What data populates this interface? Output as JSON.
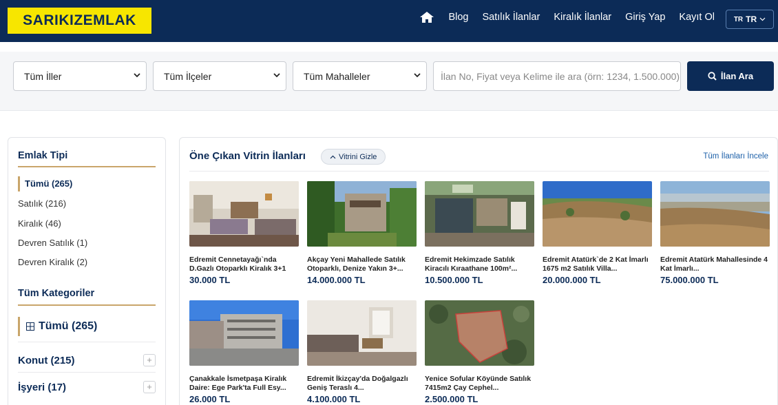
{
  "header": {
    "logo": "SARIKIZEMLAK",
    "nav": [
      "Blog",
      "Satılık İlanlar",
      "Kiralık İlanlar",
      "Giriş Yap",
      "Kayıt Ol"
    ],
    "lang_flag": "TR",
    "lang_label": "TR"
  },
  "search": {
    "province": "Tüm İller",
    "district": "Tüm İlçeler",
    "neighborhood": "Tüm Mahalleler",
    "placeholder": "İlan No, Fiyat veya Kelime ile ara (örn: 1234, 1.500.000)",
    "button": "İlan Ara"
  },
  "sidebar": {
    "type_title": "Emlak Tipi",
    "types": [
      "Tümü (265)",
      "Satılık (216)",
      "Kiralık (46)",
      "Devren Satılık (1)",
      "Devren Kiralık (2)"
    ],
    "cat_title": "Tüm Kategoriler",
    "cat_all": "Tümü (265)",
    "categories": [
      "Konut (215)",
      "İşyeri (17)"
    ]
  },
  "showcase": {
    "title": "Öne Çıkan Vitrin İlanları",
    "toggle": "Vitrini Gizle",
    "all_link": "Tüm İlanları İncele",
    "listings": [
      {
        "title": "Edremit Cennetayağı`nda D.Gazlı Otoparklı Kiralık 3+1",
        "price": "30.000 TL"
      },
      {
        "title": "Akçay Yeni Mahallede Satılık Otoparklı, Denize Yakın 3+...",
        "price": "14.000.000 TL"
      },
      {
        "title": "Edremit Hekimzade Satılık Kiracılı Kıraathane 100m²...",
        "price": "10.500.000 TL"
      },
      {
        "title": "Edremit Atatürk`de 2 Kat İmarlı 1675 m2 Satılık Villa...",
        "price": "20.000.000 TL"
      },
      {
        "title": "Edremit Atatürk Mahallesinde 4 Kat İmarlı...",
        "price": "75.000.000 TL"
      },
      {
        "title": "Çanakkale İsmetpaşa Kiralık Daire: Ege Park'ta Full Esy...",
        "price": "26.000 TL"
      },
      {
        "title": "Edremit İkizçay'da Doğalgazlı Geniş Teraslı 4...",
        "price": "4.100.000 TL"
      },
      {
        "title": "Yenice Sofular Köyünde Satılık 7415m2 Çay Cephel...",
        "price": "2.500.000 TL"
      }
    ]
  }
}
